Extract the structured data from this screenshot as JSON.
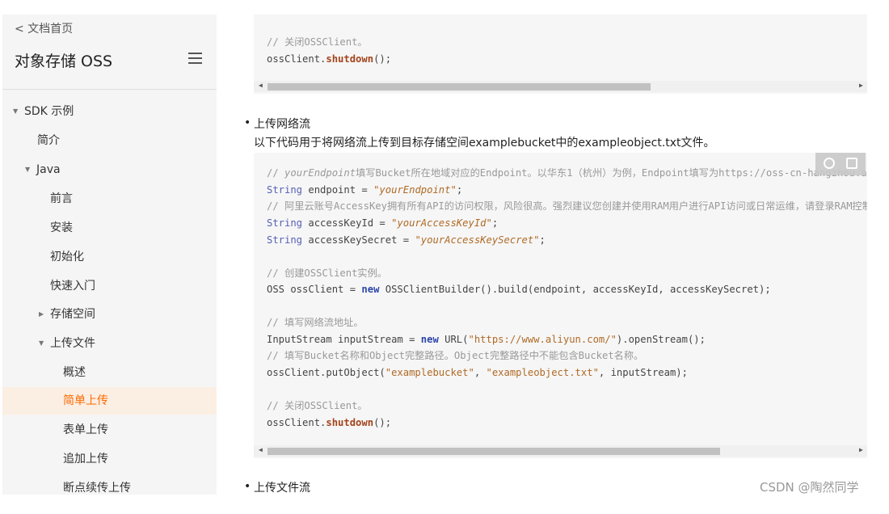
{
  "sidebar": {
    "back_link": "< 文档首页",
    "product_title": "对象存储 OSS",
    "items": [
      {
        "label": "SDK 示例",
        "caret": "▼"
      },
      {
        "label": "简介"
      },
      {
        "label": "Java",
        "caret": "▼"
      },
      {
        "label": "前言"
      },
      {
        "label": "安装"
      },
      {
        "label": "初始化"
      },
      {
        "label": "快速入门"
      },
      {
        "label": "存储空间",
        "caret": "▶"
      },
      {
        "label": "上传文件",
        "caret": "▼"
      },
      {
        "label": "概述"
      },
      {
        "label": "简单上传",
        "active": true
      },
      {
        "label": "表单上传"
      },
      {
        "label": "追加上传"
      },
      {
        "label": "断点续传上传"
      }
    ]
  },
  "code_block_1": {
    "line1": "// 关闭OSSClient。",
    "line2_obj": "ossClient.",
    "line2_method": "shutdown",
    "line2_end": "();"
  },
  "section_network": {
    "bullet": "上传网络流",
    "description": "以下代码用于将网络流上传到目标存储空间examplebucket中的exampleobject.txt文件。"
  },
  "code_block_2": {
    "l1_prefix": "// ",
    "l1_italic": "yourEndpoint",
    "l1_rest": "填写Bucket所在地域对应的Endpoint。以华东1（杭州）为例，Endpoint填写为https://oss-cn-hangzhou.aliyuncs.com。",
    "l2_type": "String",
    "l2_mid": " endpoint = ",
    "l2_str": "\"yourEndpoint\"",
    "l2_end": ";",
    "l3": "// 阿里云账号AccessKey拥有所有API的访问权限，风险很高。强烈建议您创建并使用RAM用户进行API访问或日常运维，请登录RAM控制台创建RAM用户。",
    "l4_type": "String",
    "l4_mid": " accessKeyId = ",
    "l4_str": "\"yourAccessKeyId\"",
    "l4_end": ";",
    "l5_type": "String",
    "l5_mid": " accessKeySecret = ",
    "l5_str": "\"yourAccessKeySecret\"",
    "l5_end": ";",
    "l6": "// 创建OSSClient实例。",
    "l7_a": "OSS ossClient = ",
    "l7_kw": "new",
    "l7_b": " OSSClientBuilder().build(endpoint, accessKeyId, accessKeySecret);",
    "l8": "// 填写网络流地址。",
    "l9_a": "InputStream inputStream = ",
    "l9_kw": "new",
    "l9_b": " URL(",
    "l9_str": "\"https://www.aliyun.com/\"",
    "l9_c": ").openStream();",
    "l10": "// 填写Bucket名称和Object完整路径。Object完整路径中不能包含Bucket名称。",
    "l11_a": "ossClient.putObject(",
    "l11_s1": "\"examplebucket\"",
    "l11_b": ", ",
    "l11_s2": "\"exampleobject.txt\"",
    "l11_c": ", inputStream);",
    "l12": "// 关闭OSSClient。",
    "l13_obj": "ossClient.",
    "l13_method": "shutdown",
    "l13_end": "();"
  },
  "section_file_stream": {
    "bullet": "上传文件流"
  },
  "watermark": "CSDN @陶然同学",
  "icons": {
    "scroll_left": "◀",
    "scroll_right": "▶",
    "bullet": "•"
  }
}
